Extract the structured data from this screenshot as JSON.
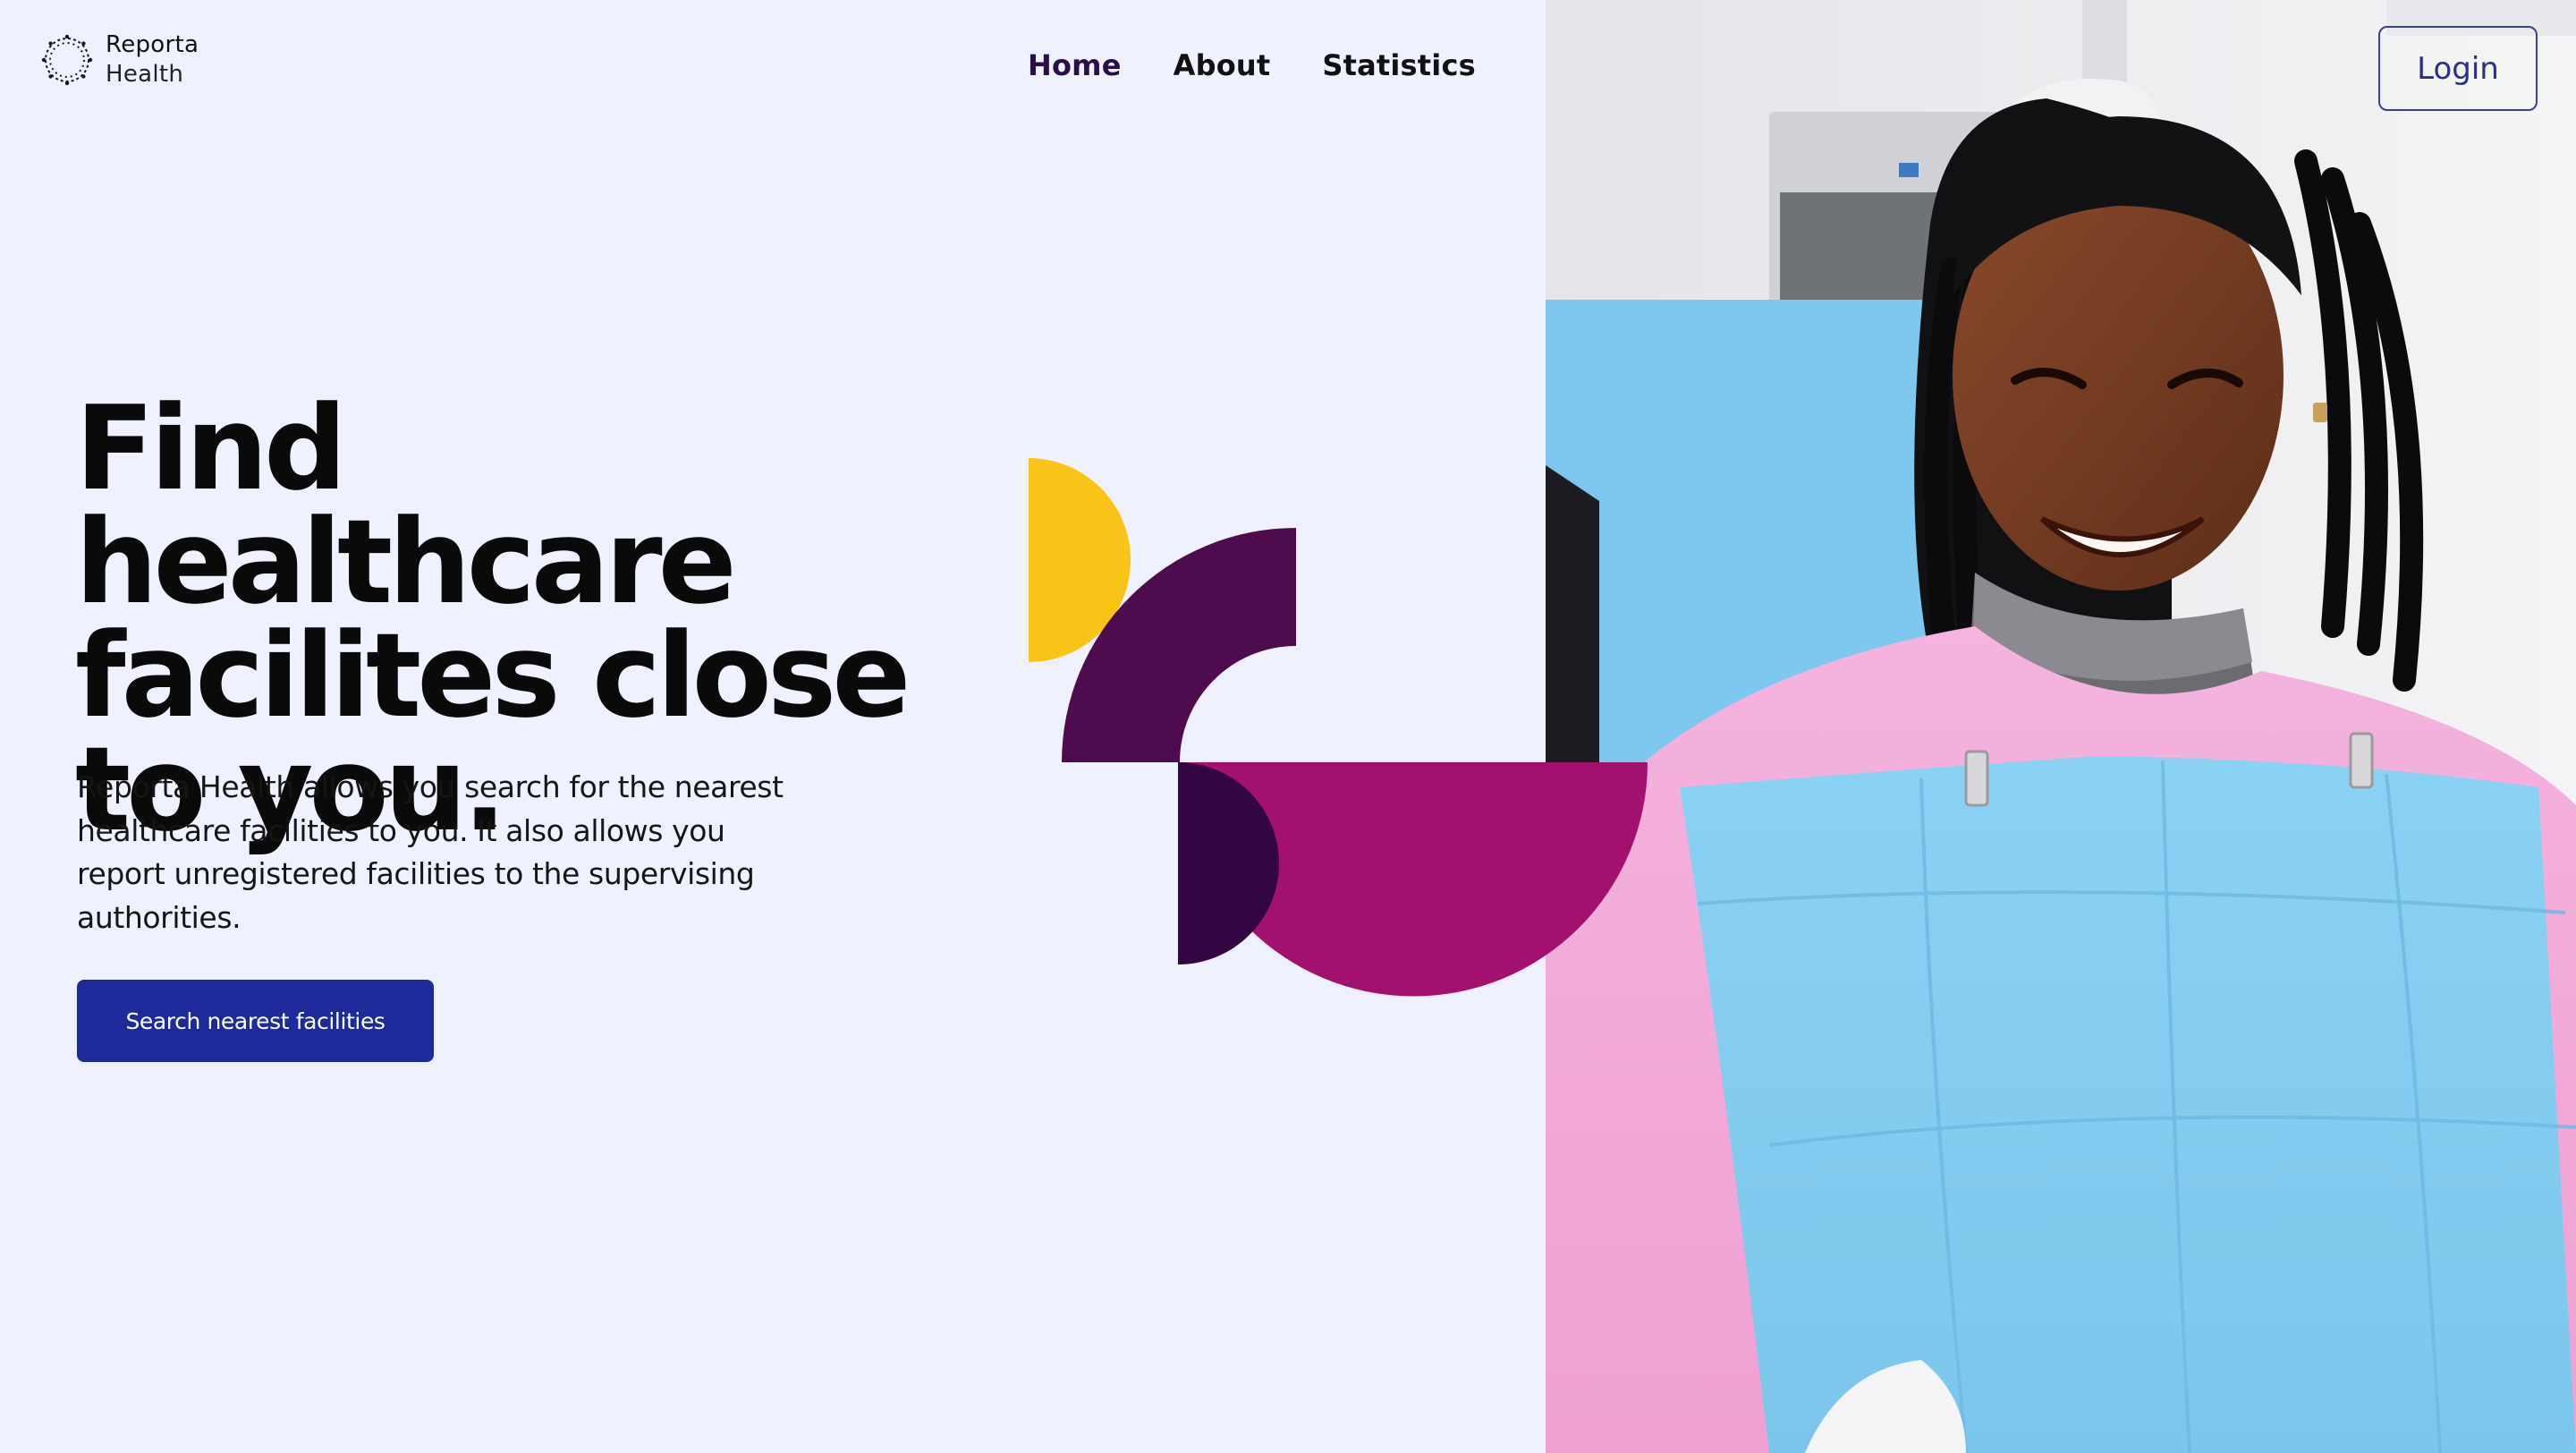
{
  "brand": {
    "name_line1": "Reporta",
    "name_line2": "Health"
  },
  "nav": {
    "items": [
      {
        "label": "Home",
        "active": true
      },
      {
        "label": "About",
        "active": false
      },
      {
        "label": "Statistics",
        "active": false
      }
    ]
  },
  "header": {
    "login_label": "Login"
  },
  "hero": {
    "title": "Find healthcare facilites close to you.",
    "description": "Reporta Health allows you search for the nearest healthcare facilities to you. It also allows you report unregistered facilities to the supervising authorities.",
    "cta_label": "Search nearest facilities"
  },
  "colors": {
    "page_background": "#eff2fe",
    "primary_button": "#1f2a9a",
    "shape_yellow": "#f7c417",
    "shape_plum": "#4e0c4f",
    "shape_magenta": "#a3116f",
    "shape_dark_purple": "#340543",
    "photo_background": "#e9eaec",
    "chair_blue": "#7fcaf0",
    "bib_pink": "#f2a5d8"
  },
  "icons": {
    "logo": "ring-of-dots-logo-icon"
  }
}
